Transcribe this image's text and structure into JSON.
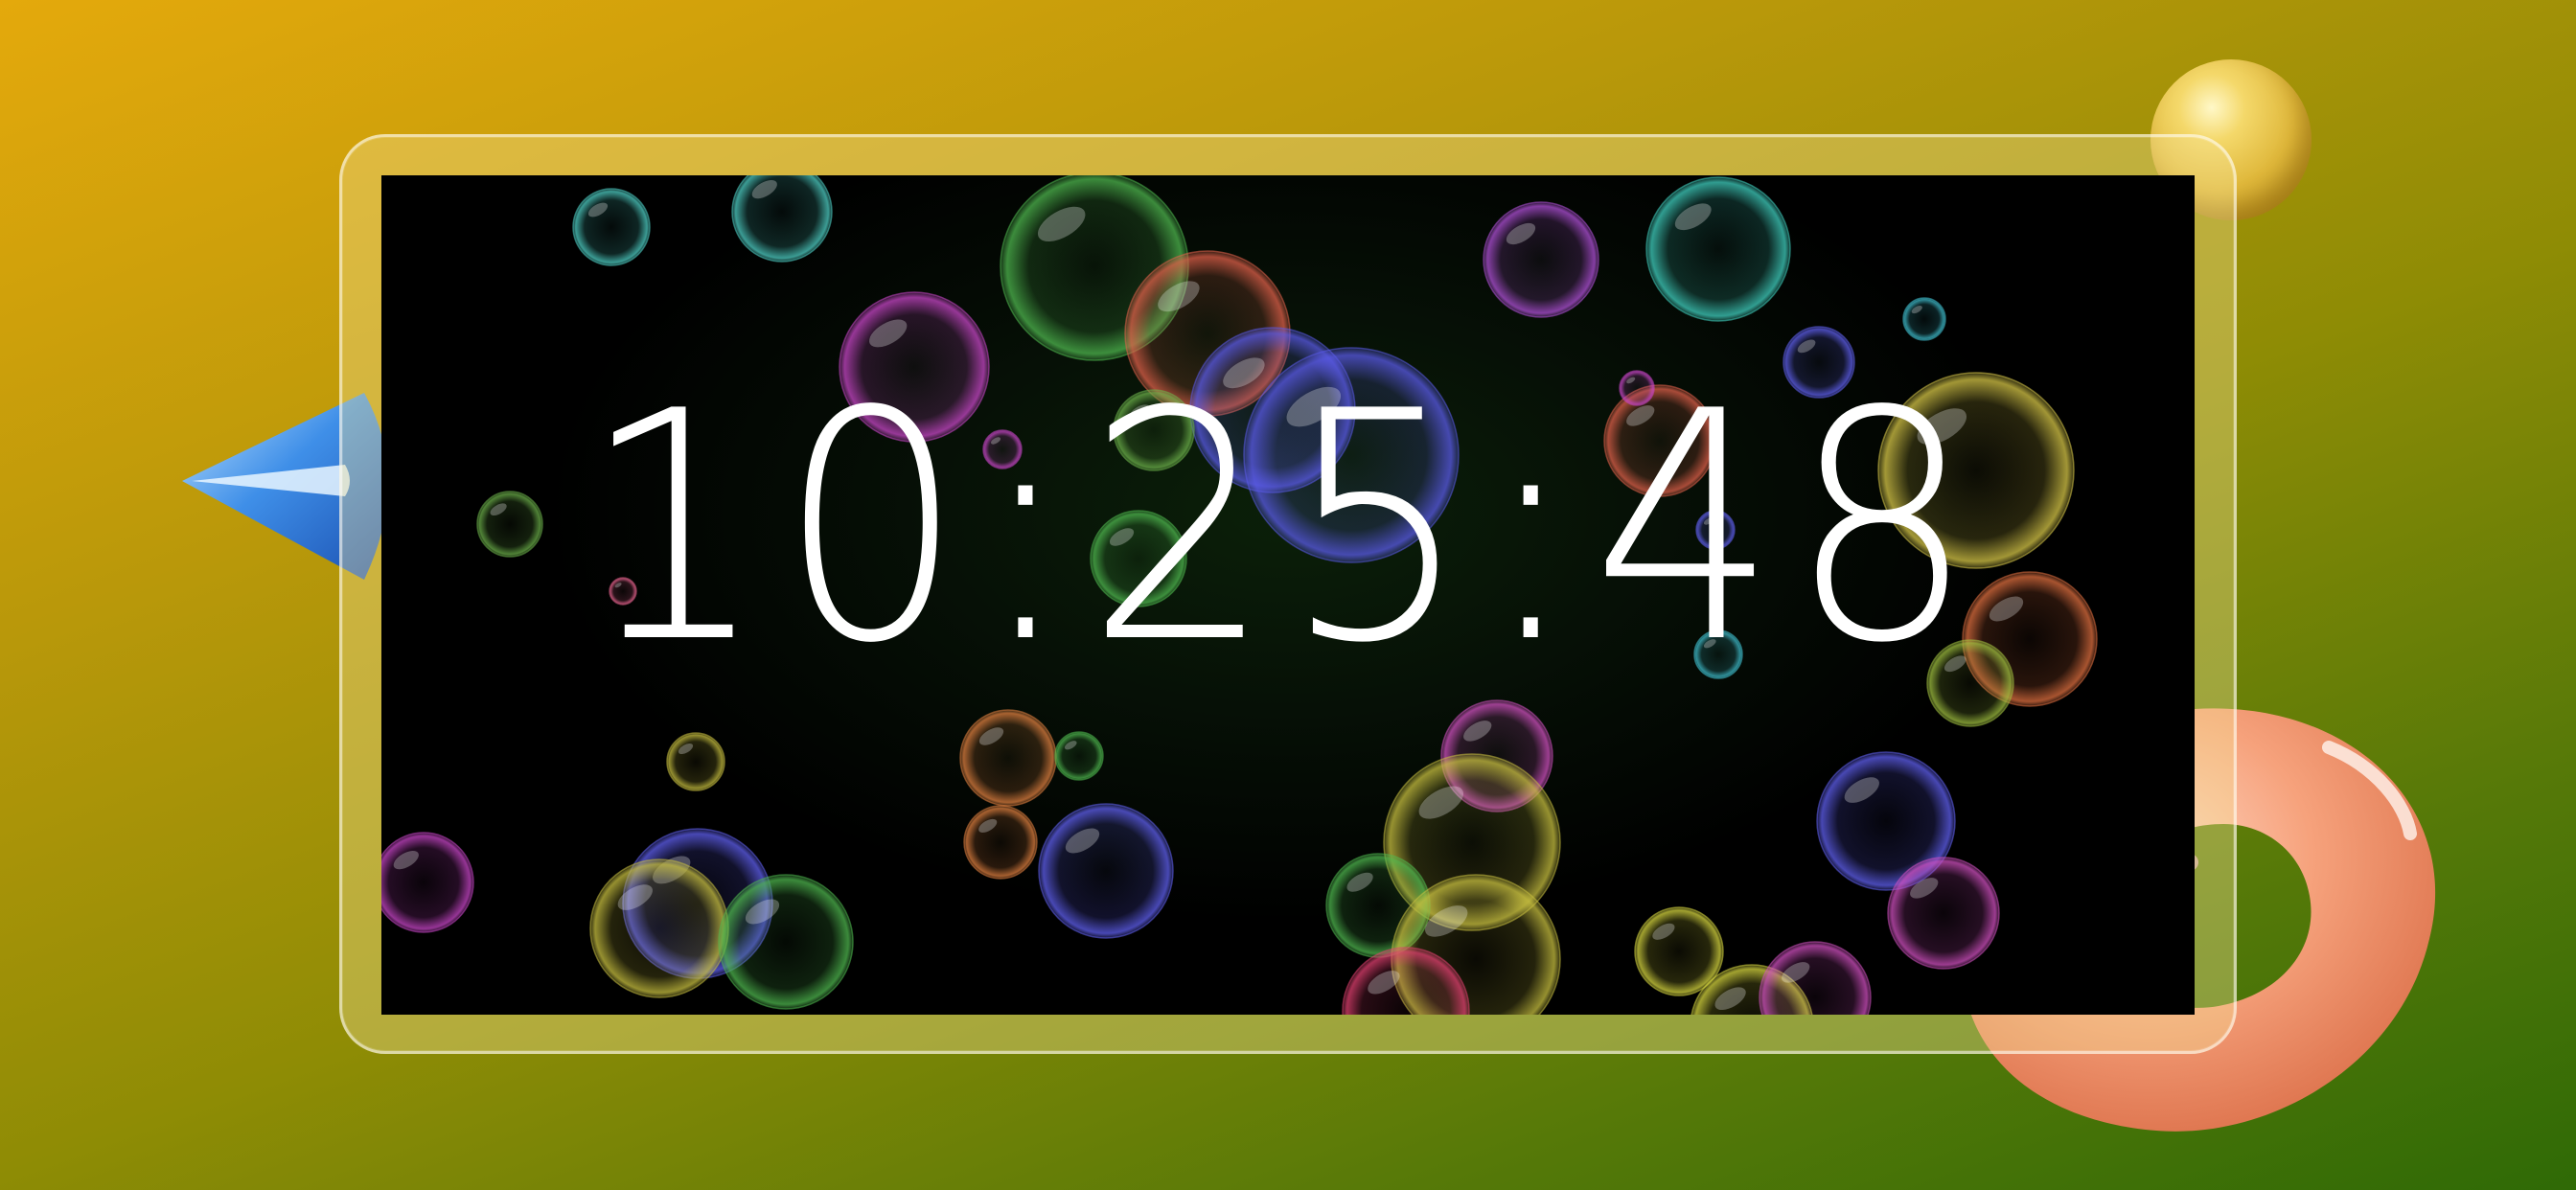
{
  "clock": {
    "time": "10:25:48"
  },
  "theme": {
    "background_start": "#e4a90c",
    "background_end": "#2f6a06",
    "screen_color": "#000000",
    "digit_color": "#ffffff",
    "frame_color": "#f5e196"
  },
  "decorations": {
    "left_shape": "blue-cone",
    "top_right_shape": "yellow-sphere",
    "bottom_right_shape": "peach-torus",
    "screen_effect": "floating-bubbles"
  }
}
